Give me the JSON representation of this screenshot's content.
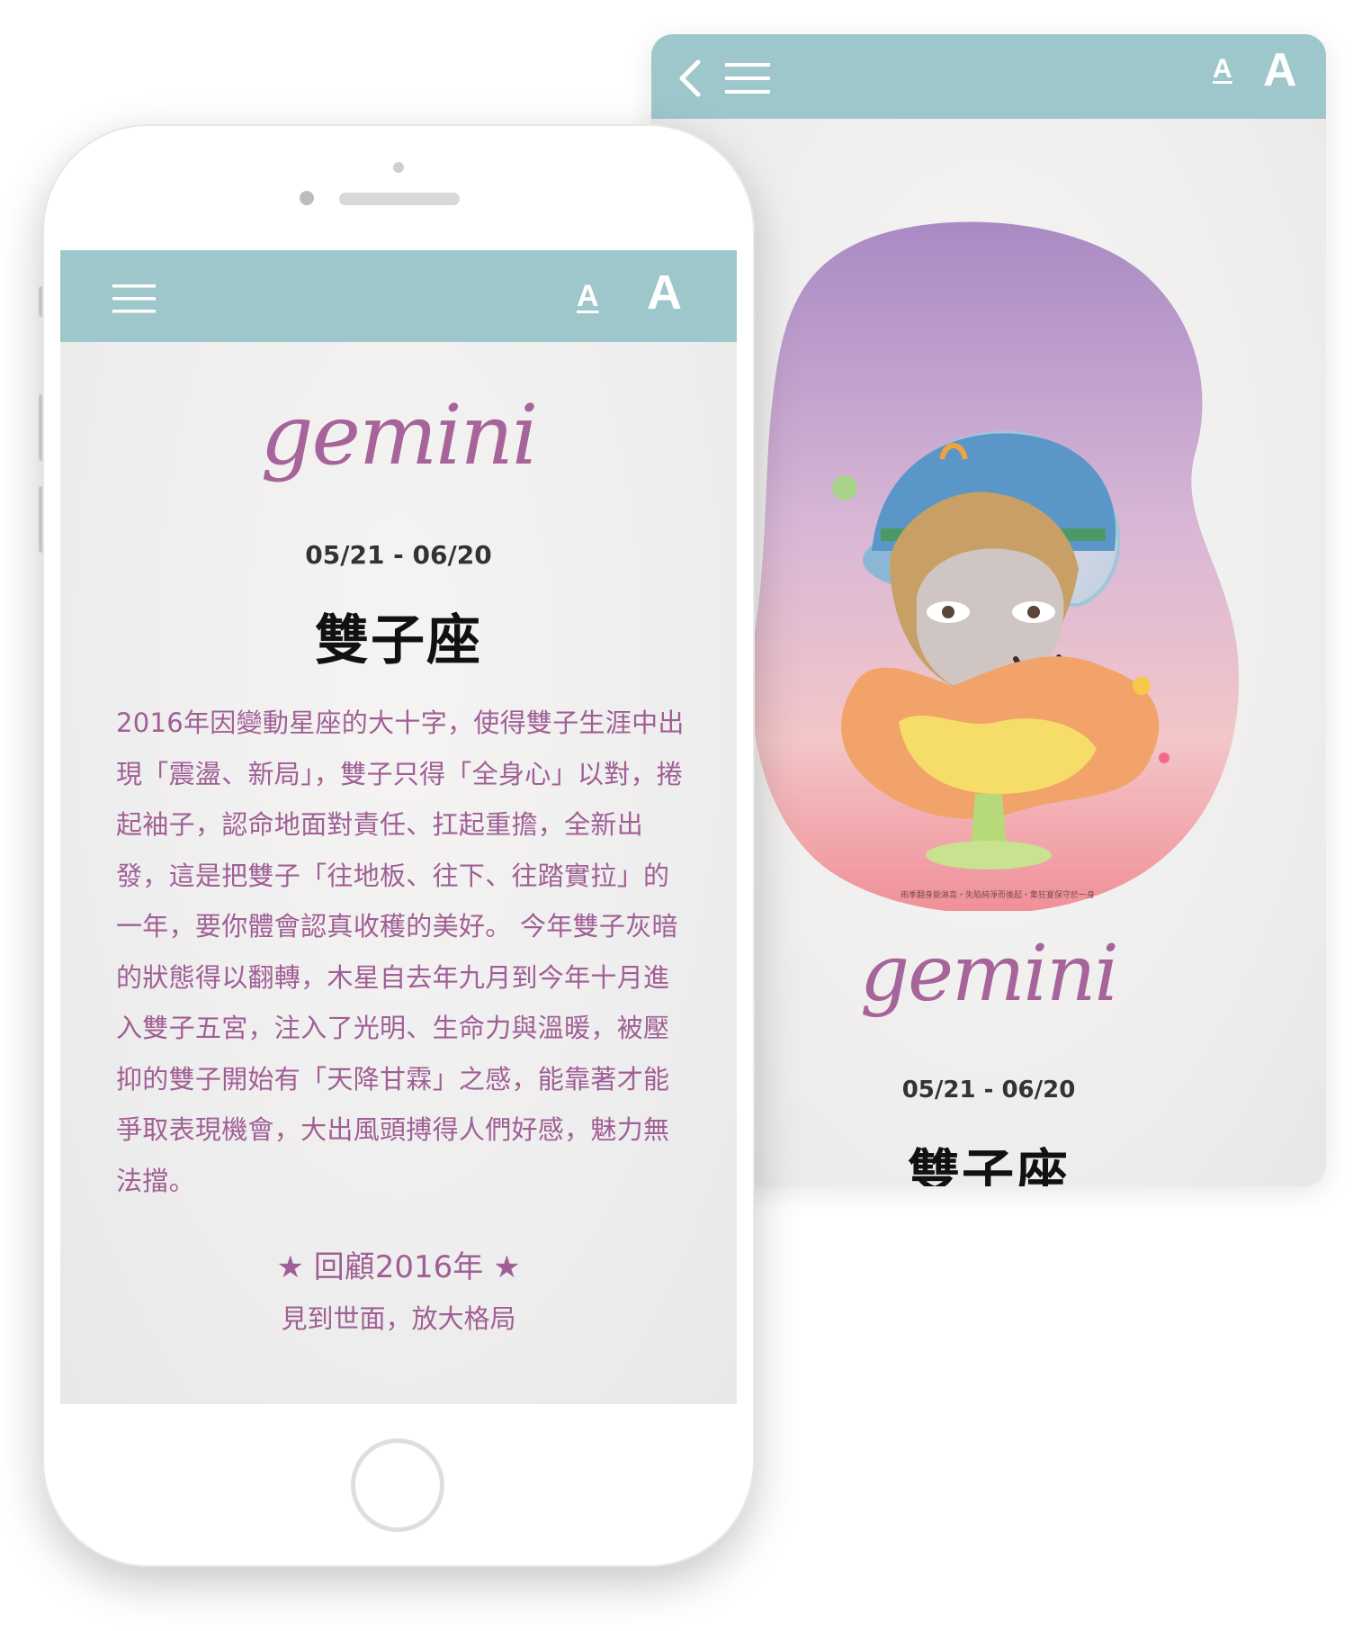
{
  "back_card": {
    "font_small_label": "A",
    "font_large_label": "A",
    "illustration_caption": "雨季翻身能淋高・失陷純淨而後起・集狂宴保守於一身",
    "sign_name_en": "gemini",
    "date_range": "05/21 - 06/20",
    "sign_name_zh": "雙子座"
  },
  "front_phone": {
    "font_small_label": "A",
    "font_large_label": "A",
    "sign_name_en": "gemini",
    "date_range": "05/21 - 06/20",
    "sign_name_zh": "雙子座",
    "description": "2016年因變動星座的大十字，使得雙子生涯中出現「震盪、新局」，雙子只得「全身心」以對，捲起袖子，認命地面對責任、扛起重擔，全新出發，這是把雙子「往地板、往下、往踏實拉」的一年，要你體會認真收穫的美好。 今年雙子灰暗的狀態得以翻轉，木星自去年九月到今年十月進入雙子五宮，注入了光明、生命力與溫暖，被壓抑的雙子開始有「天降甘霖」之感，能靠著才能爭取表現機會，大出風頭搏得人們好感，魅力無法擋。",
    "review_star_left": "★",
    "review_title": "回顧2016年",
    "review_star_right": "★",
    "review_subtitle": "見到世面，放大格局"
  },
  "colors": {
    "topbar": "#9ec7cc",
    "accent_text": "#a05f96",
    "script_title": "#a6649a"
  },
  "icons": [
    "back-arrow-icon",
    "menu-icon",
    "font-size-small-icon",
    "font-size-large-icon",
    "star-icon"
  ]
}
